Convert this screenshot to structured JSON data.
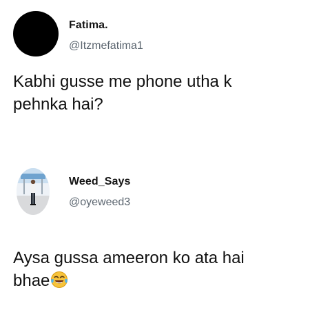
{
  "tweets": [
    {
      "display_name": "Fatima.",
      "handle": "@Itzmefatima1",
      "text": "Kabhi gusse me phone utha k pehnka hai?",
      "avatar_icon": "black-circle-avatar"
    },
    {
      "display_name": "Weed_Says",
      "handle": "@oyeweed3",
      "text": "Aysa gussa ameeron ko ata hai bhae",
      "text_emoji": "face-with-tears-of-joy-icon",
      "avatar_icon": "person-photo-avatar"
    }
  ],
  "colors": {
    "handle": "#5c6670",
    "text": "#111111",
    "emoji_face": "#f7c33b"
  }
}
